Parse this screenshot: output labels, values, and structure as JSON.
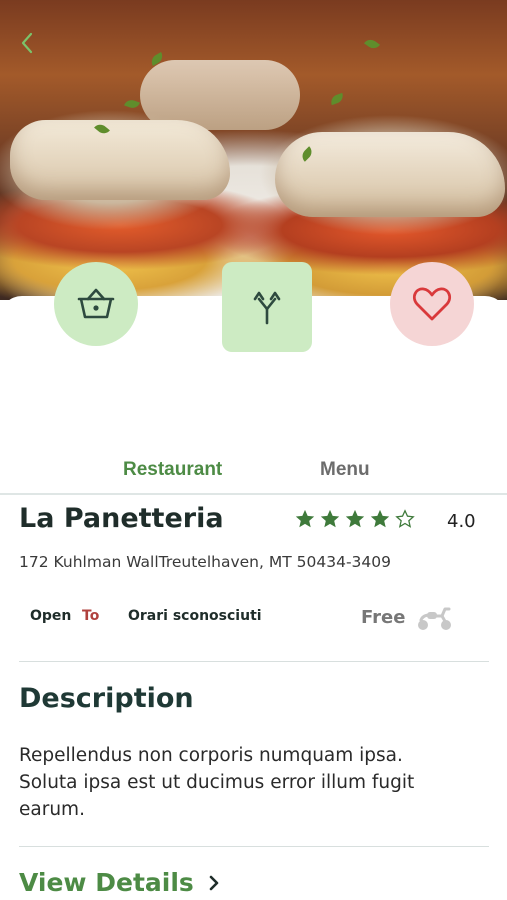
{
  "hero": {
    "image_alt": "Grilled fish on polenta with roasted peppers"
  },
  "tabs": {
    "restaurant": "Restaurant",
    "menu": "Menu",
    "active": "Restaurant"
  },
  "restaurant": {
    "name": "La Panetteria",
    "rating_value": "4.0",
    "rating_stars": 4,
    "address": "172 Kuhlman WallTreutelhaven, MT 50434-3409",
    "hours_open": "Open",
    "hours_to": "To",
    "hours_value": "Orari sconosciuti",
    "delivery": "Free"
  },
  "description": {
    "title": "Description",
    "text": "Repellendus non corporis numquam ipsa. Soluta ipsa est ut ducimus error illum fugit earum."
  },
  "actions": {
    "view_details": "View Details"
  },
  "colors": {
    "brand_green": "#4d8b45",
    "mint": "#cdebc3",
    "pink": "#f5d5d5",
    "heart_red": "#d9393b",
    "star_green": "#3f7a3b"
  },
  "icons": [
    "back-arrow-icon",
    "basket-icon",
    "route-icon",
    "heart-icon",
    "star-icon",
    "scooter-icon",
    "chevron-right-icon"
  ]
}
